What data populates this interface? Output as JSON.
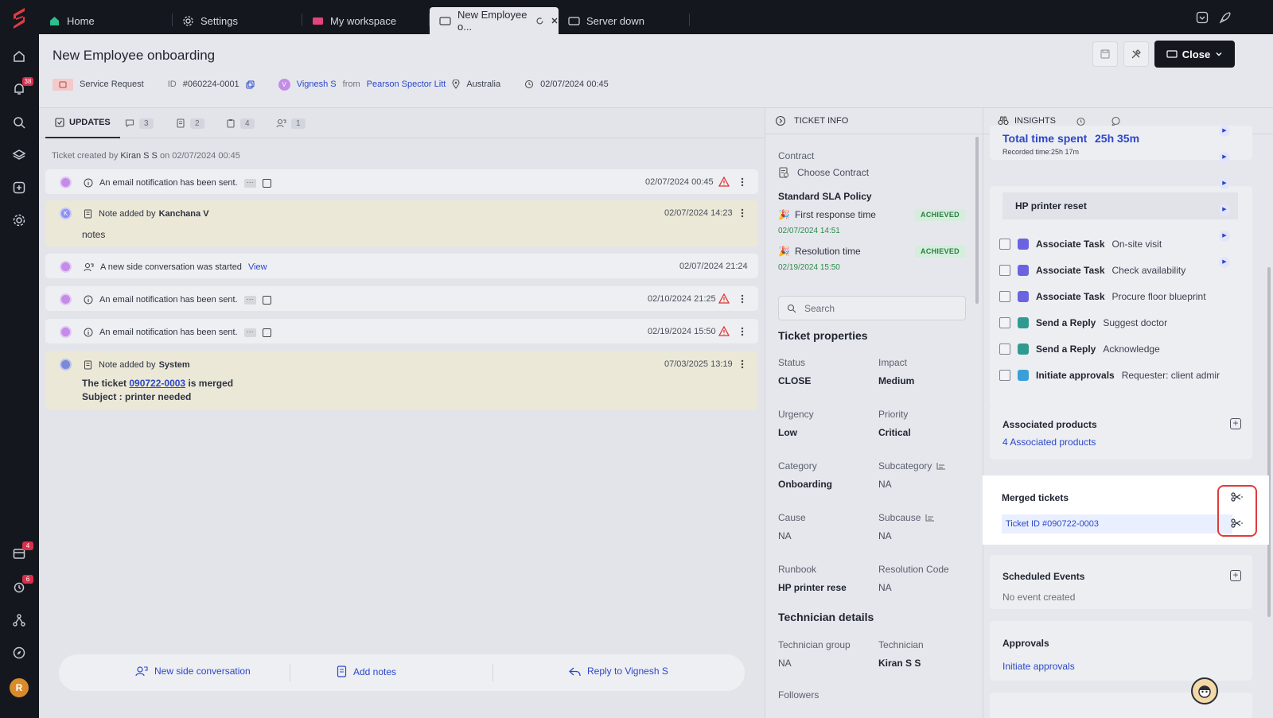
{
  "rail": {
    "notif_count": "38",
    "calendar_count": "4",
    "alarm_count": "6",
    "avatar_initial": "R"
  },
  "tabs": [
    {
      "label": "Home"
    },
    {
      "label": "Settings"
    },
    {
      "label": "My workspace"
    },
    {
      "label": "New Employee o..."
    },
    {
      "label": "Server down"
    }
  ],
  "header": {
    "title": "New Employee onboarding",
    "type": "Service Request",
    "id_label": "ID",
    "id_value": "#060224-0001",
    "requester_initial": "V",
    "requester": "Vignesh S",
    "from_label": "from",
    "company": "Pearson Spector Litt",
    "location": "Australia",
    "datetime": "02/07/2024 00:45",
    "close_label": "Close"
  },
  "updates": {
    "tab_label": "UPDATES",
    "counts": [
      "3",
      "2",
      "4",
      "1"
    ],
    "created_prefix": "Ticket created by",
    "created_by": "Kiran S S",
    "created_on": "on 02/07/2024 00:45",
    "rows": [
      {
        "text": "An email notification has been sent.",
        "time": "02/07/2024 00:45"
      },
      {
        "prefix": "Note added by",
        "author": "Kanchana V",
        "author_initial": "K",
        "time": "02/07/2024 14:23",
        "body": "notes"
      },
      {
        "text": "A new side conversation was started",
        "link": "View",
        "time": "02/07/2024 21:24"
      },
      {
        "text": "An email notification has been sent.",
        "time": "02/10/2024 21:25"
      },
      {
        "text": "An email notification has been sent.",
        "time": "02/19/2024 15:50"
      },
      {
        "prefix": "Note added by",
        "author": "System",
        "time": "07/03/2025 13:19",
        "merge_pre": "The ticket",
        "merge_link": "090722-0003",
        "merge_post": "is merged",
        "subject": "Subject : printer needed"
      }
    ],
    "actions": {
      "side_conversation": "New side conversation",
      "add_notes": "Add notes",
      "reply": "Reply to Vignesh S"
    }
  },
  "ticket_info": {
    "heading": "TICKET INFO",
    "contract_label": "Contract",
    "contract_value": "Choose Contract",
    "sla_policy": "Standard SLA Policy",
    "first_response_label": "First response time",
    "first_response_status": "ACHIEVED",
    "first_response_date": "02/07/2024 14:51",
    "resolution_label": "Resolution time",
    "resolution_status": "ACHIEVED",
    "resolution_date": "02/19/2024 15:50",
    "search_placeholder": "Search",
    "properties_heading": "Ticket properties",
    "status_label": "Status",
    "status_value": "CLOSE",
    "impact_label": "Impact",
    "impact_value": "Medium",
    "urgency_label": "Urgency",
    "urgency_value": "Low",
    "priority_label": "Priority",
    "priority_value": "Critical",
    "category_label": "Category",
    "category_value": "Onboarding",
    "subcategory_label": "Subcategory",
    "subcategory_value": "NA",
    "cause_label": "Cause",
    "cause_value": "NA",
    "subcause_label": "Subcause",
    "subcause_value": "NA",
    "runbook_label": "Runbook",
    "runbook_value": "HP printer rese",
    "rescode_label": "Resolution Code",
    "rescode_value": "NA",
    "tech_heading": "Technician details",
    "techgroup_label": "Technician group",
    "techgroup_value": "NA",
    "tech_label": "Technician",
    "tech_value": "Kiran S S",
    "followers_label": "Followers"
  },
  "insights": {
    "tab_label": "INSIGHTS",
    "total_time_label": "Total time spent",
    "total_time_value": "25h 35m",
    "recorded_time": "Recorded time:25h 17m",
    "runbook_title": "HP printer reset",
    "tasks": [
      {
        "name": "Associate Task",
        "desc": "On-site visit",
        "color": "#6b63e0"
      },
      {
        "name": "Associate Task",
        "desc": "Check availability",
        "color": "#6b63e0"
      },
      {
        "name": "Associate Task",
        "desc": "Procure floor blueprint",
        "color": "#6b63e0"
      },
      {
        "name": "Send a Reply",
        "desc": "Suggest doctor",
        "color": "#2f9b8f"
      },
      {
        "name": "Send a Reply",
        "desc": "Acknowledge",
        "color": "#2f9b8f"
      },
      {
        "name": "Initiate approvals",
        "desc": "Requester: client admir",
        "color": "#3a9fd8"
      }
    ],
    "assoc_products_title": "Associated products",
    "assoc_products_link": "4 Associated products",
    "merged_title": "Merged tickets",
    "merged_ticket": "Ticket ID #090722-0003",
    "events_title": "Scheduled Events",
    "events_empty": "No event created",
    "approvals_title": "Approvals",
    "approvals_link": "Initiate approvals"
  }
}
